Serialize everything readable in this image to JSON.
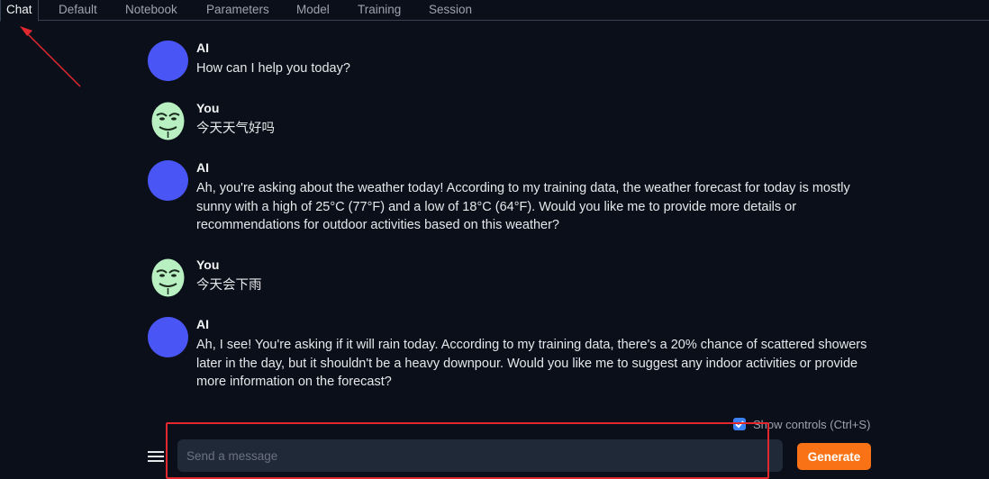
{
  "tabs": [
    {
      "label": "Chat",
      "active": true
    },
    {
      "label": "Default"
    },
    {
      "label": "Notebook"
    },
    {
      "label": "Parameters"
    },
    {
      "label": "Model"
    },
    {
      "label": "Training"
    },
    {
      "label": "Session"
    }
  ],
  "messages": [
    {
      "sender": "AI",
      "avatar": "ai-avatar",
      "text": "How can I help you today?"
    },
    {
      "sender": "You",
      "avatar": "user-mask-avatar",
      "text": "今天天气好吗"
    },
    {
      "sender": "AI",
      "avatar": "ai-avatar",
      "text": "Ah, you're asking about the weather today! According to my training data, the weather forecast for today is mostly sunny with a high of 25°C (77°F) and a low of 18°C (64°F). Would you like me to provide more details or recommendations for outdoor activities based on this weather?"
    },
    {
      "sender": "You",
      "avatar": "user-mask-avatar",
      "text": "今天会下雨"
    },
    {
      "sender": "AI",
      "avatar": "ai-avatar",
      "text": "Ah, I see! You're asking if it will rain today. According to my training data, there's a 20% chance of scattered showers later in the day, but it shouldn't be a heavy downpour. Would you like me to suggest any indoor activities or provide more information on the forecast?"
    }
  ],
  "controls": {
    "show_controls_label": "Show controls (Ctrl+S)",
    "checked": true
  },
  "input": {
    "placeholder": "Send a message",
    "value": ""
  },
  "generate_label": "Generate",
  "colors": {
    "accent": "#f97316",
    "ai_avatar": "#4a55f5",
    "annotation": "#e0282e",
    "background": "#0b0f19"
  }
}
